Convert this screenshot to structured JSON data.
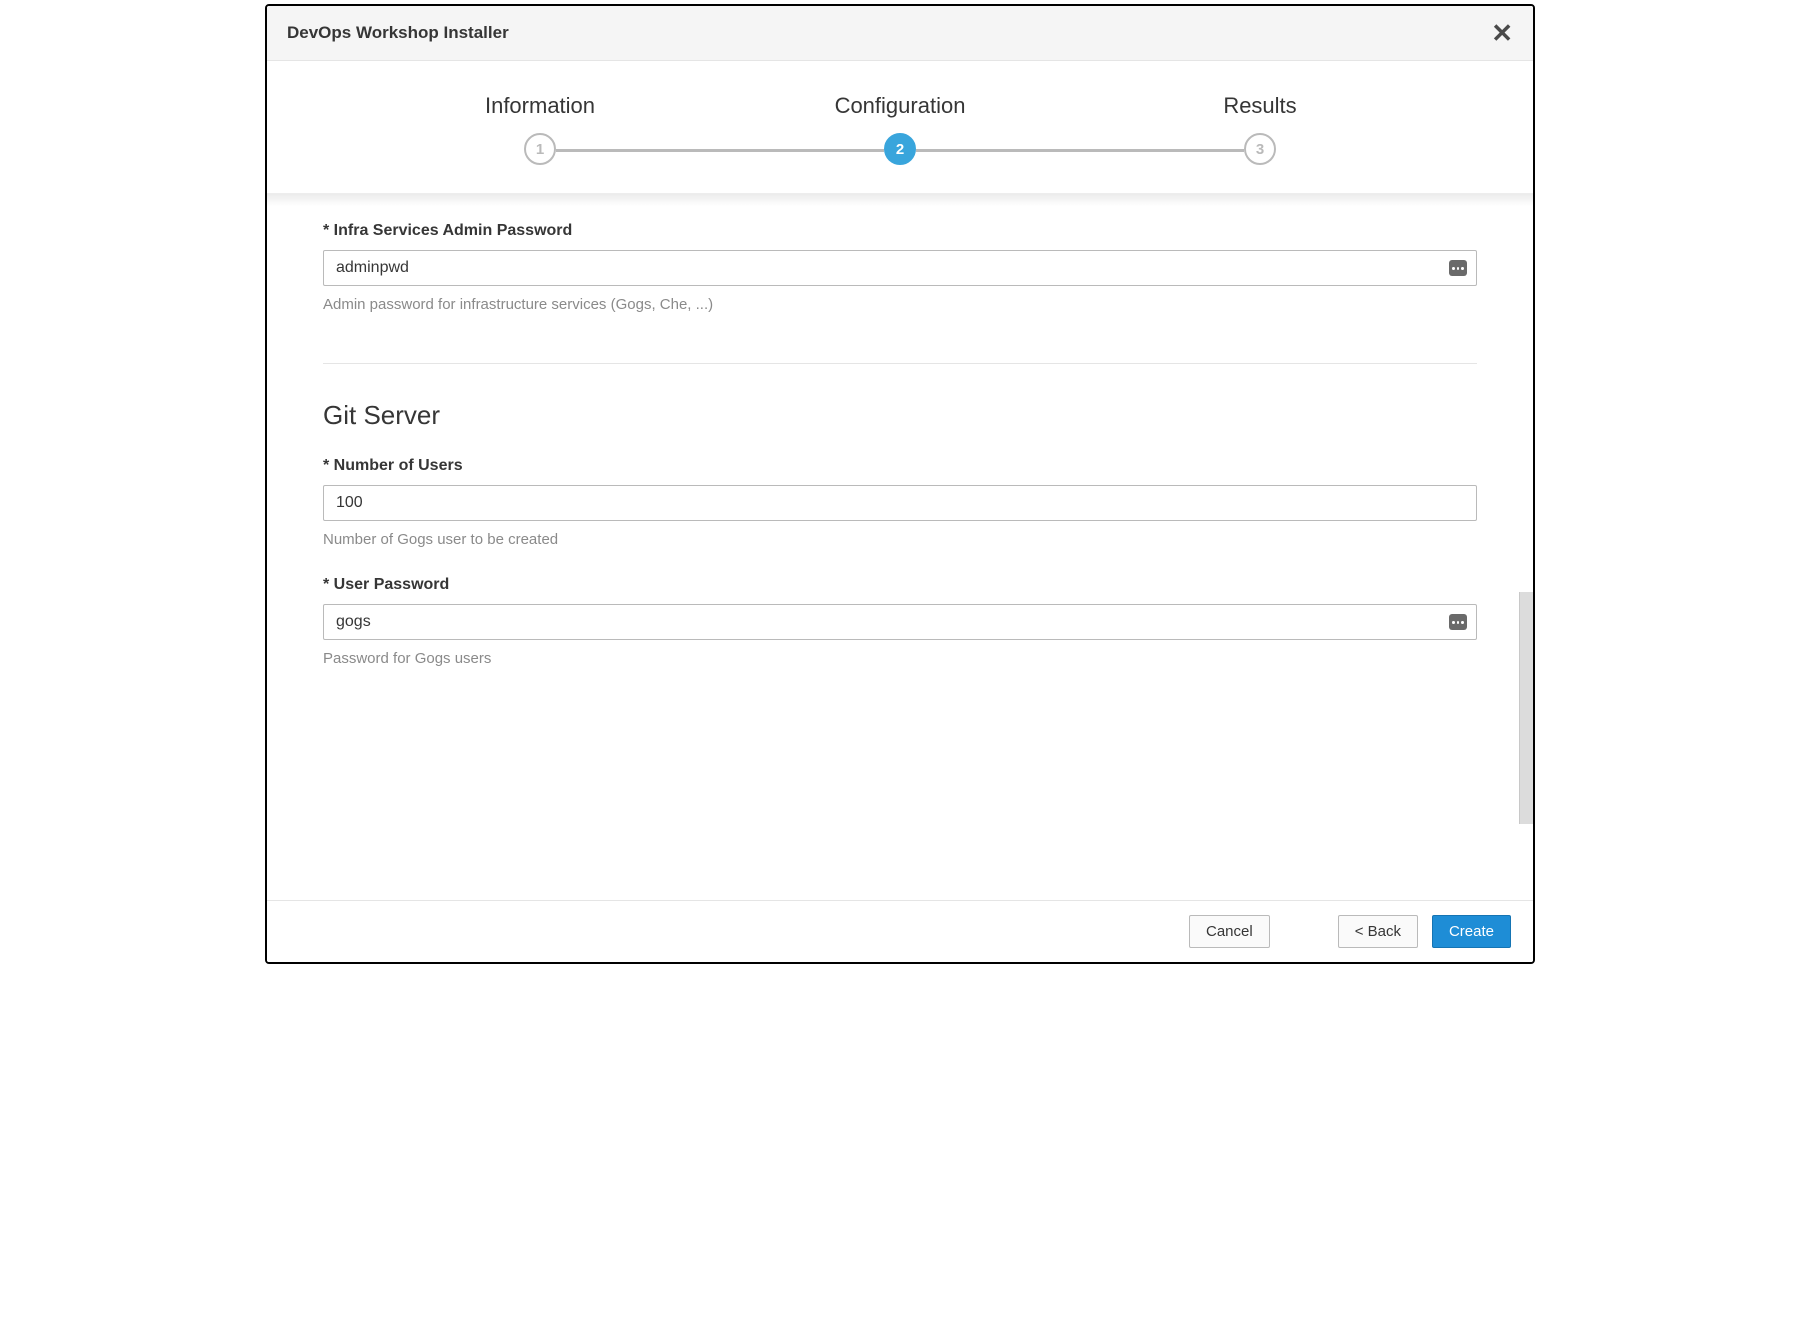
{
  "header": {
    "title": "DevOps Workshop Installer"
  },
  "steps": [
    {
      "label": "Information",
      "number": "1",
      "active": false
    },
    {
      "label": "Configuration",
      "number": "2",
      "active": true
    },
    {
      "label": "Results",
      "number": "3",
      "active": false
    }
  ],
  "form": {
    "adminPassword": {
      "label": "* Infra Services Admin Password",
      "value": "adminpwd",
      "help": "Admin password for infrastructure services (Gogs, Che, ...)"
    },
    "gitSection": {
      "title": "Git Server"
    },
    "numberOfUsers": {
      "label": "* Number of Users",
      "value": "100",
      "help": "Number of Gogs user to be created"
    },
    "userPassword": {
      "label": "* User Password",
      "value": "gogs",
      "help": "Password for Gogs users"
    }
  },
  "footer": {
    "cancel": "Cancel",
    "back": "< Back",
    "create": "Create"
  }
}
